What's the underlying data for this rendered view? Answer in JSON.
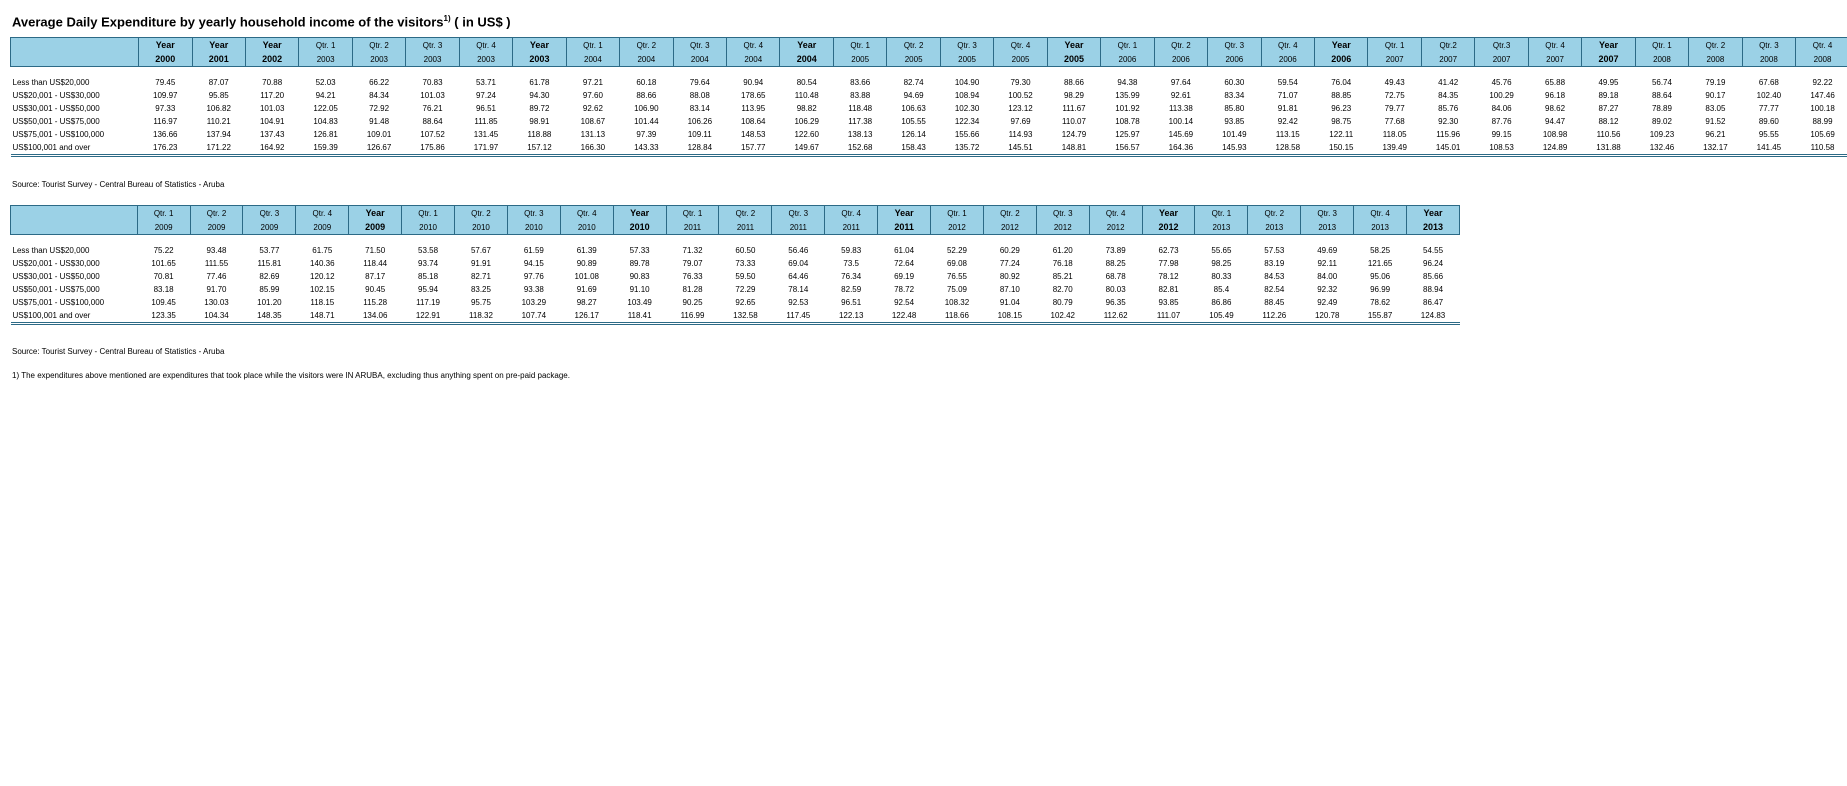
{
  "title": "Average Daily Expenditure by yearly household income of the visitors",
  "title_sup": "1)",
  "title_suffix": " ( in US$ )",
  "colors": {
    "header_bg": "#9bd1e6",
    "border": "#2c6a86"
  },
  "row_labels": [
    "Less than US$20,000",
    "US$20,001 - US$30,000",
    "US$30,001 - US$50,000",
    "US$50,001 - US$75,000",
    "US$75,001 - US$100,000",
    "US$100,001 and over"
  ],
  "table1": {
    "periods": [
      {
        "p": "Year",
        "y": "2000",
        "bold": true
      },
      {
        "p": "Year",
        "y": "2001",
        "bold": true
      },
      {
        "p": "Year",
        "y": "2002",
        "bold": true
      },
      {
        "p": "Qtr. 1",
        "y": "2003"
      },
      {
        "p": "Qtr. 2",
        "y": "2003"
      },
      {
        "p": "Qtr. 3",
        "y": "2003"
      },
      {
        "p": "Qtr. 4",
        "y": "2003"
      },
      {
        "p": "Year",
        "y": "2003",
        "bold": true
      },
      {
        "p": "Qtr. 1",
        "y": "2004"
      },
      {
        "p": "Qtr. 2",
        "y": "2004"
      },
      {
        "p": "Qtr. 3",
        "y": "2004"
      },
      {
        "p": "Qtr. 4",
        "y": "2004"
      },
      {
        "p": "Year",
        "y": "2004",
        "bold": true
      },
      {
        "p": "Qtr. 1",
        "y": "2005"
      },
      {
        "p": "Qtr. 2",
        "y": "2005"
      },
      {
        "p": "Qtr. 3",
        "y": "2005"
      },
      {
        "p": "Qtr. 4",
        "y": "2005"
      },
      {
        "p": "Year",
        "y": "2005",
        "bold": true
      },
      {
        "p": "Qtr. 1",
        "y": "2006"
      },
      {
        "p": "Qtr. 2",
        "y": "2006"
      },
      {
        "p": "Qtr. 3",
        "y": "2006"
      },
      {
        "p": "Qtr. 4",
        "y": "2006"
      },
      {
        "p": "Year",
        "y": "2006",
        "bold": true
      },
      {
        "p": "Qtr. 1",
        "y": "2007"
      },
      {
        "p": "Qtr.2",
        "y": "2007"
      },
      {
        "p": "Qtr.3",
        "y": "2007"
      },
      {
        "p": "Qtr. 4",
        "y": "2007"
      },
      {
        "p": "Year",
        "y": "2007",
        "bold": true
      },
      {
        "p": "Qtr. 1",
        "y": "2008"
      },
      {
        "p": "Qtr. 2",
        "y": "2008"
      },
      {
        "p": "Qtr. 3",
        "y": "2008"
      },
      {
        "p": "Qtr. 4",
        "y": "2008"
      }
    ],
    "rows": [
      [
        "79.45",
        "87.07",
        "70.88",
        "52.03",
        "66.22",
        "70.83",
        "53.71",
        "61.78",
        "97.21",
        "60.18",
        "79.64",
        "90.94",
        "80.54",
        "83.66",
        "82.74",
        "104.90",
        "79.30",
        "88.66",
        "94.38",
        "97.64",
        "60.30",
        "59.54",
        "76.04",
        "49.43",
        "41.42",
        "45.76",
        "65.88",
        "49.95",
        "56.74",
        "79.19",
        "67.68",
        "92.22"
      ],
      [
        "109.97",
        "95.85",
        "117.20",
        "94.21",
        "84.34",
        "101.03",
        "97.24",
        "94.30",
        "97.60",
        "88.66",
        "88.08",
        "178.65",
        "110.48",
        "83.88",
        "94.69",
        "108.94",
        "100.52",
        "98.29",
        "135.99",
        "92.61",
        "83.34",
        "71.07",
        "88.85",
        "72.75",
        "84.35",
        "100.29",
        "96.18",
        "89.18",
        "88.64",
        "90.17",
        "102.40",
        "147.46"
      ],
      [
        "97.33",
        "106.82",
        "101.03",
        "122.05",
        "72.92",
        "76.21",
        "96.51",
        "89.72",
        "92.62",
        "106.90",
        "83.14",
        "113.95",
        "98.82",
        "118.48",
        "106.63",
        "102.30",
        "123.12",
        "111.67",
        "101.92",
        "113.38",
        "85.80",
        "91.81",
        "96.23",
        "79.77",
        "85.76",
        "84.06",
        "98.62",
        "87.27",
        "78.89",
        "83.05",
        "77.77",
        "100.18"
      ],
      [
        "116.97",
        "110.21",
        "104.91",
        "104.83",
        "91.48",
        "88.64",
        "111.85",
        "98.91",
        "108.67",
        "101.44",
        "106.26",
        "108.64",
        "106.29",
        "117.38",
        "105.55",
        "122.34",
        "97.69",
        "110.07",
        "108.78",
        "100.14",
        "93.85",
        "92.42",
        "98.75",
        "77.68",
        "92.30",
        "87.76",
        "94.47",
        "88.12",
        "89.02",
        "91.52",
        "89.60",
        "88.99"
      ],
      [
        "136.66",
        "137.94",
        "137.43",
        "126.81",
        "109.01",
        "107.52",
        "131.45",
        "118.88",
        "131.13",
        "97.39",
        "109.11",
        "148.53",
        "122.60",
        "138.13",
        "126.14",
        "155.66",
        "114.93",
        "124.79",
        "125.97",
        "145.69",
        "101.49",
        "113.15",
        "122.11",
        "118.05",
        "115.96",
        "99.15",
        "108.98",
        "110.56",
        "109.23",
        "96.21",
        "95.55",
        "105.69"
      ],
      [
        "176.23",
        "171.22",
        "164.92",
        "159.39",
        "126.67",
        "175.86",
        "171.97",
        "157.12",
        "166.30",
        "143.33",
        "128.84",
        "157.77",
        "149.67",
        "152.68",
        "158.43",
        "135.72",
        "145.51",
        "148.81",
        "156.57",
        "164.36",
        "145.93",
        "128.58",
        "150.15",
        "139.49",
        "145.01",
        "108.53",
        "124.89",
        "131.88",
        "132.46",
        "132.17",
        "141.45",
        "110.58"
      ]
    ]
  },
  "source1": "Source: Tourist Survey - Central Bureau of Statistics - Aruba",
  "table2": {
    "periods": [
      {
        "p": "Qtr. 1",
        "y": "2009"
      },
      {
        "p": "Qtr. 2",
        "y": "2009"
      },
      {
        "p": "Qtr. 3",
        "y": "2009"
      },
      {
        "p": "Qtr. 4",
        "y": "2009"
      },
      {
        "p": "Year",
        "y": "2009",
        "bold": true
      },
      {
        "p": "Qtr. 1",
        "y": "2010"
      },
      {
        "p": "Qtr. 2",
        "y": "2010"
      },
      {
        "p": "Qtr. 3",
        "y": "2010"
      },
      {
        "p": "Qtr. 4",
        "y": "2010"
      },
      {
        "p": "Year",
        "y": "2010",
        "bold": true
      },
      {
        "p": "Qtr. 1",
        "y": "2011"
      },
      {
        "p": "Qtr. 2",
        "y": "2011"
      },
      {
        "p": "Qtr. 3",
        "y": "2011"
      },
      {
        "p": "Qtr. 4",
        "y": "2011"
      },
      {
        "p": "Year",
        "y": "2011",
        "bold": true
      },
      {
        "p": "Qtr. 1",
        "y": "2012"
      },
      {
        "p": "Qtr. 2",
        "y": "2012"
      },
      {
        "p": "Qtr. 3",
        "y": "2012"
      },
      {
        "p": "Qtr. 4",
        "y": "2012"
      },
      {
        "p": "Year",
        "y": "2012",
        "bold": true
      },
      {
        "p": "Qtr. 1",
        "y": "2013"
      },
      {
        "p": "Qtr. 2",
        "y": "2013"
      },
      {
        "p": "Qtr. 3",
        "y": "2013"
      },
      {
        "p": "Qtr. 4",
        "y": "2013"
      },
      {
        "p": "Year",
        "y": "2013",
        "bold": true
      }
    ],
    "rows": [
      [
        "75.22",
        "93.48",
        "53.77",
        "61.75",
        "71.50",
        "53.58",
        "57.67",
        "61.59",
        "61.39",
        "57.33",
        "71.32",
        "60.50",
        "56.46",
        "59.83",
        "61.04",
        "52.29",
        "60.29",
        "61.20",
        "73.89",
        "62.73",
        "55.65",
        "57.53",
        "49.69",
        "58.25",
        "54.55"
      ],
      [
        "101.65",
        "111.55",
        "115.81",
        "140.36",
        "118.44",
        "93.74",
        "91.91",
        "94.15",
        "90.89",
        "89.78",
        "79.07",
        "73.33",
        "69.04",
        "73.5",
        "72.64",
        "69.08",
        "77.24",
        "76.18",
        "88.25",
        "77.98",
        "98.25",
        "83.19",
        "92.11",
        "121.65",
        "96.24"
      ],
      [
        "70.81",
        "77.46",
        "82.69",
        "120.12",
        "87.17",
        "85.18",
        "82.71",
        "97.76",
        "101.08",
        "90.83",
        "76.33",
        "59.50",
        "64.46",
        "76.34",
        "69.19",
        "76.55",
        "80.92",
        "85.21",
        "68.78",
        "78.12",
        "80.33",
        "84.53",
        "84.00",
        "95.06",
        "85.66"
      ],
      [
        "83.18",
        "91.70",
        "85.99",
        "102.15",
        "90.45",
        "95.94",
        "83.25",
        "93.38",
        "91.69",
        "91.10",
        "81.28",
        "72.29",
        "78.14",
        "82.59",
        "78.72",
        "75.09",
        "87.10",
        "82.70",
        "80.03",
        "82.81",
        "85.4",
        "82.54",
        "92.32",
        "96.99",
        "88.94"
      ],
      [
        "109.45",
        "130.03",
        "101.20",
        "118.15",
        "115.28",
        "117.19",
        "95.75",
        "103.29",
        "98.27",
        "103.49",
        "90.25",
        "92.65",
        "92.53",
        "96.51",
        "92.54",
        "108.32",
        "91.04",
        "80.79",
        "96.35",
        "93.85",
        "86.86",
        "88.45",
        "92.49",
        "78.62",
        "86.47"
      ],
      [
        "123.35",
        "104.34",
        "148.35",
        "148.71",
        "134.06",
        "122.91",
        "118.32",
        "107.74",
        "126.17",
        "118.41",
        "116.99",
        "132.58",
        "117.45",
        "122.13",
        "122.48",
        "118.66",
        "108.15",
        "102.42",
        "112.62",
        "111.07",
        "105.49",
        "112.26",
        "120.78",
        "155.87",
        "124.83"
      ]
    ]
  },
  "source2": "Source: Tourist Survey - Central Bureau of Statistics - Aruba",
  "footnote": "1) The expenditures above mentioned are expenditures that took place while the visitors were IN ARUBA, excluding thus anything spent on pre-paid package."
}
